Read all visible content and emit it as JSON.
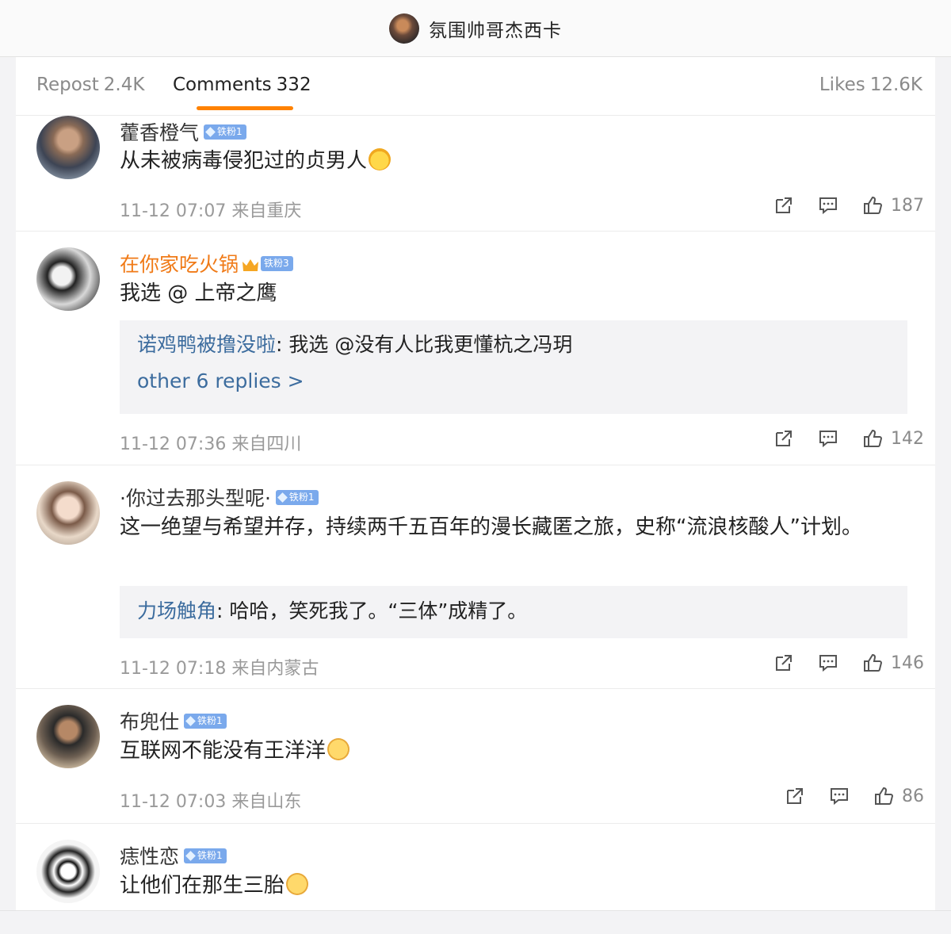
{
  "header": {
    "title": "氛围帅哥杰西卡"
  },
  "tabs": {
    "repost_label": "Repost",
    "repost_count": "2.4K",
    "comments_label": "Comments",
    "comments_count": "332",
    "likes_label": "Likes",
    "likes_count": "12.6K"
  },
  "comments": [
    {
      "name": "藿香橙气",
      "badge": "铁粉1",
      "text": "从未被病毒侵犯过的贞男人",
      "time": "11-12 07:07 来自重庆",
      "likes": "187"
    },
    {
      "name": "在你家吃火锅",
      "badge": "铁粉3",
      "text": "我选 @ 上帝之鹰",
      "time": "11-12 07:36 来自四川",
      "likes": "142",
      "reply": {
        "user": "诺鸡鸭被撸没啦",
        "text": "我选 @没有人比我更懂杭之冯玥"
      },
      "more": "other 6 replies >"
    },
    {
      "name": "·你过去那头型呢·",
      "badge": "铁粉1",
      "text": "这一绝望与希望并存，持续两千五百年的漫长藏匿之旅，史称“流浪核酸人”计划。",
      "time": "11-12 07:18 来自内蒙古",
      "likes": "146",
      "reply": {
        "user": "力场触角",
        "text": "哈哈，笑死我了。“三体”成精了。"
      }
    },
    {
      "name": "布兜仕",
      "badge": "铁粉1",
      "text": "互联网不能没有王洋洋",
      "time": "11-12 07:03 来自山东",
      "likes": "86"
    },
    {
      "name": "痣性恋",
      "badge": "铁粉1",
      "text": "让他们在那生三胎"
    }
  ],
  "colors": {
    "accent": "#ff8200",
    "link": "#3c6c9e",
    "vip_name": "#f07a17",
    "badge": "#7aa9ec"
  },
  "icons": [
    "share-icon",
    "comment-icon",
    "like-icon"
  ]
}
